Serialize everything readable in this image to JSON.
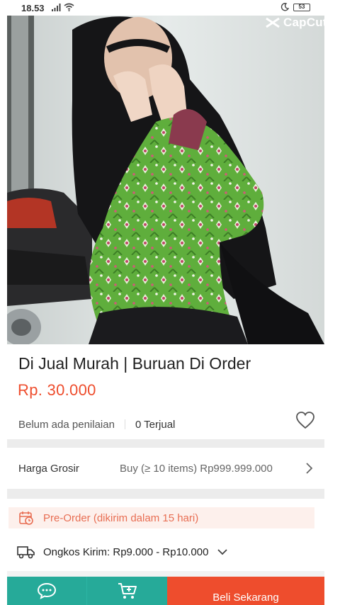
{
  "status_bar": {
    "time": "18.53",
    "battery": "53",
    "signal_icon": "signal-icon",
    "wifi_icon": "wifi-icon",
    "moon_icon": "moon-icon"
  },
  "watermark": {
    "text": "CapCut"
  },
  "product": {
    "title": "Di Jual Murah | Buruan Di Order",
    "price": "Rp. 30.000",
    "rating_text": "Belum ada penilaian",
    "sold_text": "0 Terjual",
    "favorite_icon": "heart-icon"
  },
  "wholesale": {
    "label": "Harga Grosir",
    "value": "Buy (≥ 10 items) Rp999.999.000"
  },
  "preorder": {
    "text": "Pre-Order (dikirim dalam 15 hari)"
  },
  "shipping": {
    "text": "Ongkos Kirim: Rp9.000 - Rp10.000"
  },
  "bottom_bar": {
    "chat_icon": "chat-icon",
    "cart_icon": "add-to-cart-icon",
    "buy_label": "Beli Sekarang"
  },
  "colors": {
    "price": "#ee4d2d",
    "buy_button": "#ee4d2d",
    "chat_cart_buttons": "#26aa99",
    "preorder_bg": "#fdf0ec",
    "preorder_text": "#e86e53"
  }
}
